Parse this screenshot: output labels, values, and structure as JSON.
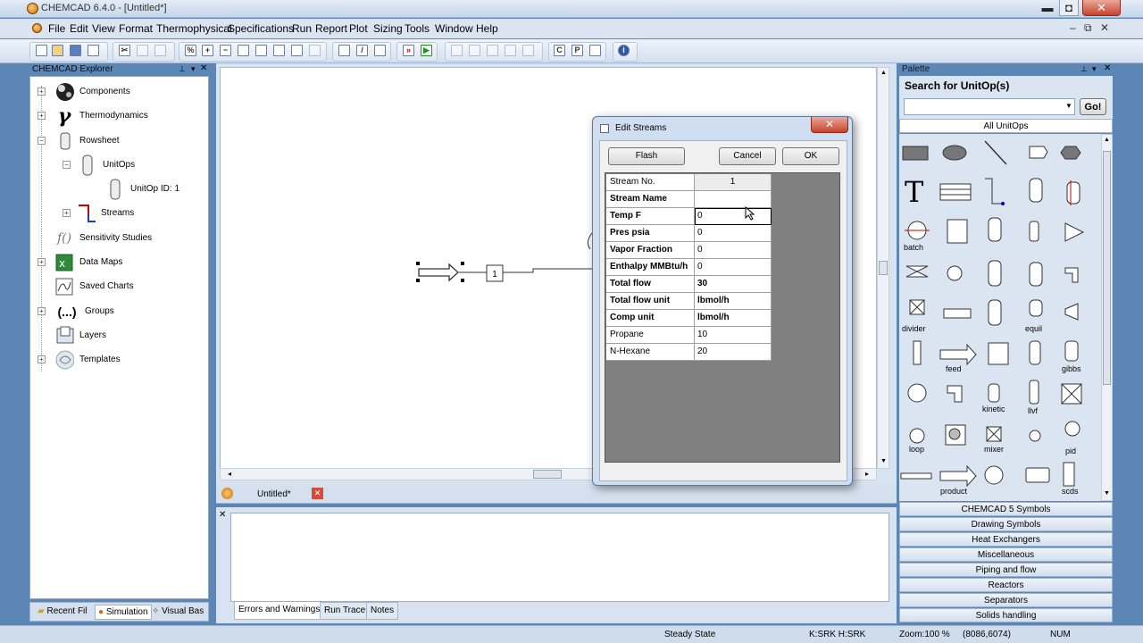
{
  "app": {
    "title": "CHEMCAD 6.4.0 - [Untitled*]"
  },
  "menu": [
    "File",
    "Edit",
    "View",
    "Format",
    "Thermophysical",
    "Specifications",
    "Run",
    "Report",
    "Plot",
    "Sizing",
    "Tools",
    "Window",
    "Help"
  ],
  "toolbar": {
    "c_label": "C",
    "p_label": "P",
    "info": "i"
  },
  "explorer": {
    "title": "CHEMCAD Explorer",
    "items": [
      {
        "label": "Components"
      },
      {
        "label": "Thermodynamics"
      },
      {
        "label": "Rowsheet"
      },
      {
        "label": "UnitOps"
      },
      {
        "label": "UnitOp ID: 1"
      },
      {
        "label": "Streams"
      },
      {
        "label": "Sensitivity Studies"
      },
      {
        "label": "Data Maps"
      },
      {
        "label": "Saved Charts"
      },
      {
        "label": "Groups"
      },
      {
        "label": "Layers"
      },
      {
        "label": "Templates"
      }
    ],
    "groups_icon": "(...)",
    "tabs": [
      "Recent Fil",
      "Simulation",
      "Visual Bas"
    ]
  },
  "flowsheet": {
    "stream_id": "1",
    "doc_tab": "Untitled*"
  },
  "output": {
    "tabs": [
      "Errors and Warnings",
      "Run Trace",
      "Notes"
    ]
  },
  "dialog": {
    "title": "Edit Streams",
    "flash_label": "Flash",
    "cancel_label": "Cancel",
    "ok_label": "OK",
    "rows": [
      {
        "label": "Stream No.",
        "value": "1"
      },
      {
        "label": "Stream Name",
        "value": ""
      },
      {
        "label": "Temp  F",
        "value": "0"
      },
      {
        "label": "Pres  psia",
        "value": "0"
      },
      {
        "label": "Vapor Fraction",
        "value": "0"
      },
      {
        "label": "Enthalpy MMBtu/h",
        "value": "0"
      },
      {
        "label": "Total flow",
        "value": "30"
      },
      {
        "label": "Total flow unit",
        "value": "lbmol/h"
      },
      {
        "label": "Comp unit",
        "value": "lbmol/h"
      },
      {
        "label": "Propane",
        "value": "10"
      },
      {
        "label": "N-Hexane",
        "value": "20"
      }
    ]
  },
  "palette": {
    "title": "Palette",
    "search_label": "Search for UnitOp(s)",
    "go_label": "Go!",
    "all_unitops": "All UnitOps",
    "labels": {
      "batch": "batch",
      "divider": "divider",
      "equil": "equil",
      "feed": "feed",
      "gibbs": "gibbs",
      "kinetic": "kinetic",
      "llvf": "llvf",
      "loop": "loop",
      "mixer": "mixer",
      "pid": "pid",
      "product": "product",
      "scds": "scds"
    },
    "text_symbol": "T",
    "categories": [
      "CHEMCAD 5 Symbols",
      "Drawing Symbols",
      "Heat Exchangers",
      "Miscellaneous",
      "Piping and flow",
      "Reactors",
      "Separators",
      "Solids handling"
    ]
  },
  "status": {
    "mode": "Steady State",
    "thermo": "K:SRK H:SRK",
    "zoom": "Zoom:100 %",
    "coords": "(8086,6074)",
    "num": "NUM"
  }
}
